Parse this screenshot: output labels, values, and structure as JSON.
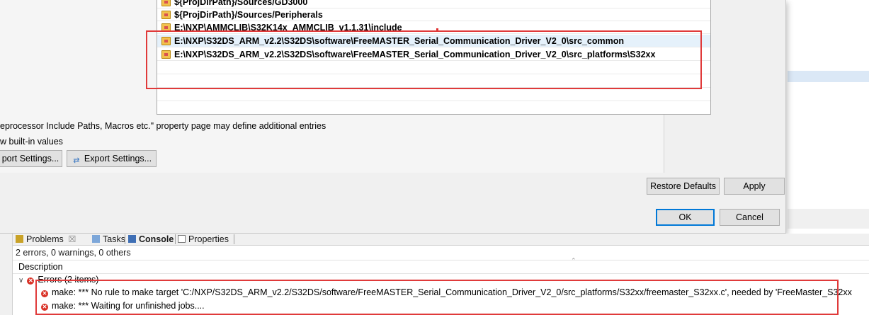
{
  "dialog": {
    "include_paths": [
      "${ProjDirPath}/Sources/GD3000",
      "${ProjDirPath}/Sources/Peripherals",
      "E:\\NXP\\AMMCLIB\\S32K14x_AMMCLIB_v1.1.31\\include",
      "E:\\NXP\\S32DS_ARM_v2.2\\S32DS\\software\\FreeMASTER_Serial_Communication_Driver_V2_0\\src_common",
      "E:\\NXP\\S32DS_ARM_v2.2\\S32DS\\software\\FreeMASTER_Serial_Communication_Driver_V2_0\\src_platforms\\S32xx"
    ],
    "note_text": "eprocessor Include Paths, Macros etc.\" property page may define additional entries",
    "builtin_text": "w built-in values",
    "import_settings_label": "port Settings...",
    "export_settings_label": "Export Settings...",
    "restore_defaults_label": "Restore Defaults",
    "apply_label": "Apply",
    "ok_label": "OK",
    "cancel_label": "Cancel"
  },
  "panel": {
    "tabs": {
      "problems": "Problems",
      "problems_close": "☒",
      "tasks": "Tasks",
      "console": "Console",
      "properties": "Properties"
    },
    "summary": "2 errors, 0 warnings, 0 others",
    "column_description": "Description",
    "errors_group": "Errors (2 items)",
    "errors": [
      "make: *** No rule to make target 'C:/NXP/S32DS_ARM_v2.2/S32DS/software/FreeMASTER_Serial_Communication_Driver_V2_0/src_platforms/S32xx/freemaster_S32xx.c', needed by 'FreeMaster_S32xx",
      "make: *** Waiting for unfinished jobs...."
    ]
  },
  "colors": {
    "highlight_border": "#e03a3a",
    "error_icon": "#d93025",
    "selection": "#e5f1fb"
  }
}
